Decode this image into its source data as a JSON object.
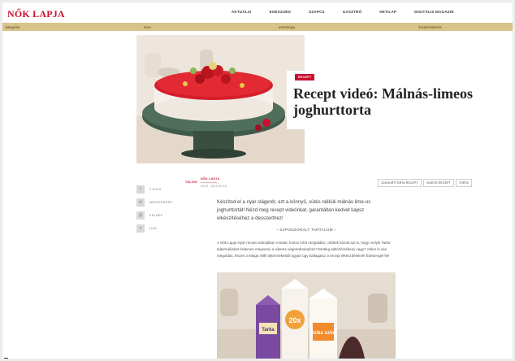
{
  "header": {
    "logo": "NŐK LAPJA",
    "nav": [
      "AKTUÁLIS",
      "EGÉSZSÉG",
      "SZAPCS",
      "GASZTRÓ",
      "HETILAP",
      "DIGITÁLIS MAGAZIN"
    ]
  },
  "subbar": {
    "items": [
      "kategória",
      "tövei",
      "asztrológia",
      "önkatéroskérés"
    ]
  },
  "hero": {
    "badge": "RECEPT",
    "title": "Recept videó: Málnás-limeos joghurttorta"
  },
  "share": [
    {
      "icon": "facebook-icon",
      "label": "2 KÜLD"
    },
    {
      "icon": "messenger-icon",
      "label": "MESSZENGER"
    },
    {
      "icon": "email-icon",
      "label": "KÜLDÉS"
    },
    {
      "icon": "link-icon",
      "label": "LINK"
    }
  ],
  "meta": {
    "category": "TÁLIOS",
    "author": "NŐK LAPJA",
    "date": "2024. JÚLIUS 08."
  },
  "tags": [
    "JOGHURTTORTA RECEPT",
    "VIDEOS RECEPT",
    "TORTA"
  ],
  "article": {
    "lead": "Készítsd el a nyár slágerét, ezt a könnyű, sütés nélküli málnás lime-os joghurttortát! Nézd meg recept videónkat, garantáltan kedvet kapsz elkészítéséhez a desszerthez!",
    "sponsored": "– SZPONZORÁLT TARTALOM –",
    "paragraph": "A Nők Lapja Nyár recept videójában minden fontos infót megtalálsz, többek között azt is, hogy melyik Tarka tejtermékeket érdemes megvenni a sikeres végeredményhez! Esetleg laktózérzékeny vagy? Akkor is van megoldás, hiszen a Magic Milk tejtermékeiből ugyan úgy ballagatsz a recept elkészítésénél! Édesengel fel!"
  },
  "product": {
    "carton_label_1": "Tarka",
    "carton_label_2": "20x",
    "carton_label_3": "ízlés szín"
  }
}
